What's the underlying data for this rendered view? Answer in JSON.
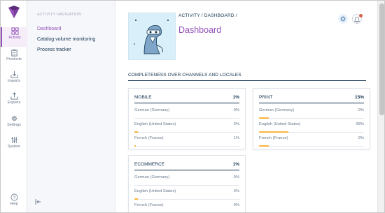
{
  "sidebar": {
    "items": [
      {
        "label": "Activity",
        "icon": "dashboard-grid-icon",
        "active": true
      },
      {
        "label": "Products",
        "icon": "clipboard-icon",
        "active": false
      },
      {
        "label": "Imports",
        "icon": "import-tray-icon",
        "active": false
      },
      {
        "label": "Exports",
        "icon": "export-tray-icon",
        "active": false
      },
      {
        "label": "Settings",
        "icon": "gear-icon",
        "active": false
      },
      {
        "label": "System",
        "icon": "sliders-icon",
        "active": false
      },
      {
        "label": "Help",
        "icon": "help-circle-icon",
        "active": false
      }
    ]
  },
  "subnav": {
    "title": "ACTIVITY NAVIGATION",
    "items": [
      {
        "label": "Dashboard",
        "active": true
      },
      {
        "label": "Catalog volume monitoring",
        "active": false
      },
      {
        "label": "Process tracker",
        "active": false
      }
    ]
  },
  "header": {
    "breadcrumb": "ACTIVITY / DASHBOARD /",
    "title": "Dashboard"
  },
  "section": {
    "title": "COMPLETENESS OVER CHANNELS AND LOCALES"
  },
  "channels": [
    {
      "name": "MOBILE",
      "percent": "1%",
      "locales": [
        {
          "label": "German (Germany)",
          "value": "0%",
          "fraction": 0.0
        },
        {
          "label": "English (United States)",
          "value": "3%",
          "fraction": 0.03
        },
        {
          "label": "French (France)",
          "value": "1%",
          "fraction": 0.01
        }
      ]
    },
    {
      "name": "PRINT",
      "percent": "15%",
      "locales": [
        {
          "label": "German (Germany)",
          "value": "9%",
          "fraction": 0.09
        },
        {
          "label": "English (United States)",
          "value": "28%",
          "fraction": 0.28
        },
        {
          "label": "French (France)",
          "value": "9%",
          "fraction": 0.09
        }
      ]
    },
    {
      "name": "ECOMMERCE",
      "percent": "1%",
      "locales": [
        {
          "label": "German (Germany)",
          "value": "0%",
          "fraction": 0.0
        },
        {
          "label": "English (United States)",
          "value": "3%",
          "fraction": 0.03
        },
        {
          "label": "French (France)",
          "value": "0%",
          "fraction": 0.0
        }
      ]
    }
  ],
  "colors": {
    "accent": "#9452ba",
    "text": "#11324d",
    "progress": "#f9b53f",
    "notification": "#d4604b"
  }
}
